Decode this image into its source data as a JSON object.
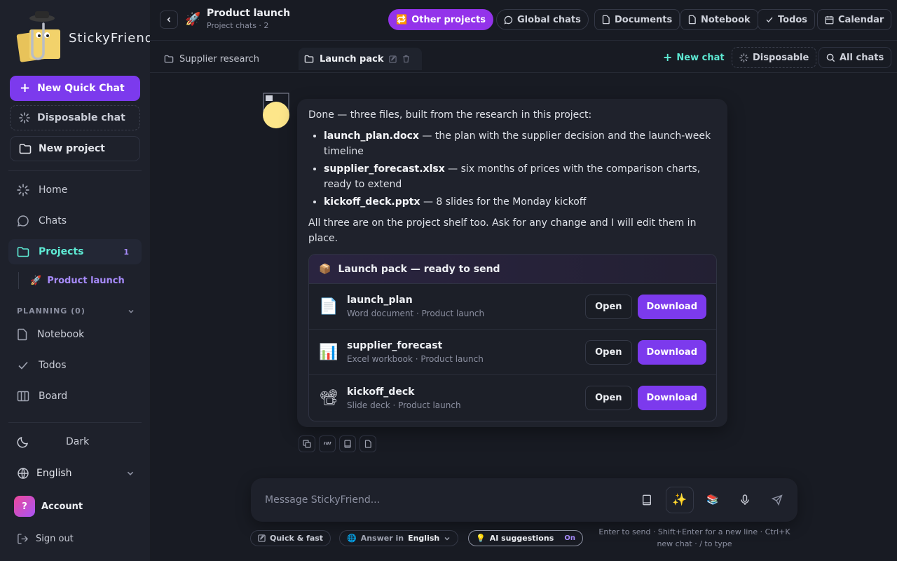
{
  "sidebar": {
    "brand": "StickyFriend",
    "new_quick_chat": "New Quick Chat",
    "disposable_chat": "Disposable chat",
    "new_project": "New project",
    "nav": {
      "home": "Home",
      "chats": "Chats",
      "projects": "Projects",
      "projects_count": "1",
      "product_launch": "Product launch",
      "product_launch_emoji": "🚀"
    },
    "planning_header": "PLANNING (0)",
    "planning": {
      "notebook": "Notebook",
      "todos": "Todos",
      "board": "Board"
    },
    "theme_label": "Dark",
    "language": "English",
    "account_initial": "?",
    "account": "Account",
    "sign_out": "Sign out"
  },
  "header": {
    "project_emoji": "🚀",
    "project_title": "Product launch",
    "project_sub": "Project chats · 2",
    "other_projects": "Other projects",
    "other_projects_emoji": "🔁",
    "global_chats": "Global chats",
    "documents": "Documents",
    "notebook": "Notebook",
    "todos": "Todos",
    "calendar": "Calendar"
  },
  "subtabs": {
    "tab1": "Supplier research",
    "tab2": "Launch pack",
    "new_chat": "New chat",
    "disposable": "Disposable",
    "all_chats": "All chats"
  },
  "message": {
    "intro": "Done — three files, built from the research in this project:",
    "bullets": [
      {
        "file": "launch_plan.docx",
        "desc": " — the plan with the supplier decision and the launch-week timeline"
      },
      {
        "file": "supplier_forecast.xlsx",
        "desc": " — six months of prices with the comparison charts, ready to extend"
      },
      {
        "file": "kickoff_deck.pptx",
        "desc": " — 8 slides for the Monday kickoff"
      }
    ],
    "outro": "All three are on the project shelf too. Ask for any change and I will edit them in place.",
    "pack": {
      "emoji": "📦",
      "title": "Launch pack — ready to send",
      "files": [
        {
          "icon": "📄",
          "name": "launch_plan",
          "meta": "Word document · Product launch",
          "open": "Open",
          "download": "Download"
        },
        {
          "icon": "📊",
          "name": "supplier_forecast",
          "meta": "Excel workbook · Product launch",
          "open": "Open",
          "download": "Download"
        },
        {
          "icon": "📽",
          "name": "kickoff_deck",
          "meta": "Slide deck · Product launch",
          "open": "Open",
          "download": "Download"
        }
      ]
    }
  },
  "composer": {
    "placeholder": "Message StickyFriend...",
    "quick_fast": "Quick & fast",
    "answer_in_label": "Answer in",
    "answer_in_value": "English",
    "ai_suggestions": "AI suggestions",
    "ai_suggestions_state": "On",
    "hint": "Enter to send · Shift+Enter for a new line · Ctrl+K new chat · / to type"
  },
  "colors": {
    "accent": "#7c3aed",
    "teal": "#5eead4",
    "background": "#181b23"
  }
}
